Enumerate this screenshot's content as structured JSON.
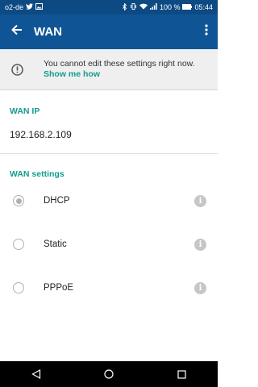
{
  "status_bar": {
    "carrier": "o2-de",
    "battery": "100 %",
    "time": "05:44"
  },
  "app_bar": {
    "title": "WAN",
    "back_icon": "back-arrow-icon",
    "menu_icon": "more-vert-icon"
  },
  "banner": {
    "message": "You cannot edit these settings right now.",
    "link": "Show me how",
    "icon": "alert-circle-icon"
  },
  "wan_ip": {
    "label": "WAN IP",
    "value": "192.168.2.109"
  },
  "wan_settings": {
    "label": "WAN settings",
    "options": [
      {
        "label": "DHCP",
        "selected": true
      },
      {
        "label": "Static",
        "selected": false
      },
      {
        "label": "PPPoE",
        "selected": false
      }
    ]
  },
  "colors": {
    "status_bar": "#0d4a83",
    "app_bar": "#0f5595",
    "accent": "#129b8e",
    "banner_bg": "#efefef"
  }
}
